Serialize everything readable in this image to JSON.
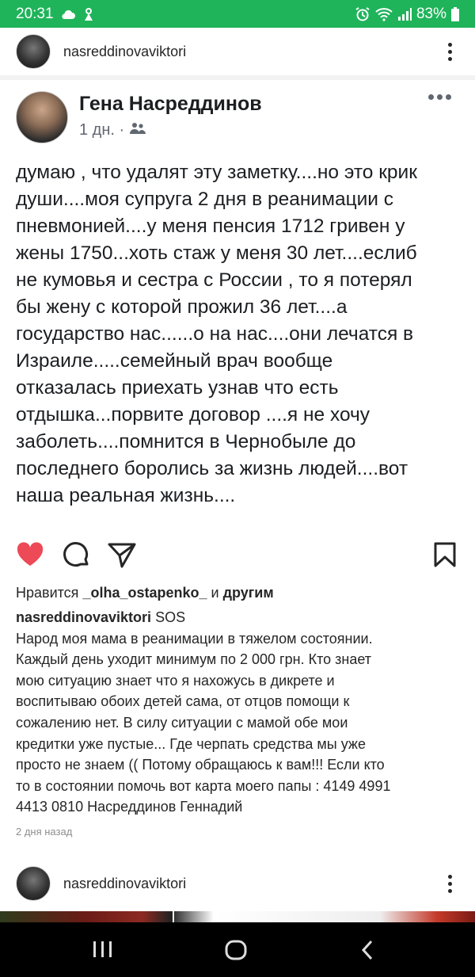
{
  "status_bar": {
    "time": "20:31",
    "battery": "83%"
  },
  "post": {
    "username": "nasreddinovaviktori",
    "image": {
      "author": "Гена Насреддинов",
      "meta": "1 дн. ·",
      "text": "думаю , что удалят эту заметку....но это крик\nдуши....моя супруга 2 дня в реанимации с\nпневмонией....у меня пенсия 1712 гривен у\nжены 1750...хоть стаж у меня 30 лет....еслиб\nне кумовья и сестра с России , то я потерял\nбы жену с которой прожил 36 лет....а\nгосударство нас......о на нас....они лечатся в\nИзраиле.....семейный врач вообще\nотказалась приехать узнав что есть\nотдышка...порвите договор ....я не хочу\nзаболеть....помнится в Чернобыле до\nпоследнего боролись за жизнь людей....вот\nнаша реальная жизнь...."
    },
    "likes": {
      "prefix": "Нравится ",
      "user": "_olha_ostapenko_",
      "middle": " и ",
      "others": "другим"
    },
    "caption": {
      "user": "nasreddinovaviktori",
      "text": " SOS\nНарод моя мама в реанимации в тяжелом состоянии.\nКаждый день уходит минимум по 2 000 грн. Кто знает\nмою ситуацию знает что я нахожусь в дикрете и\nвоспитываю обоих детей сама, от отцов помощи к\nсожалению  нет. В силу ситуации с мамой обе мои\nкредитки уже пустые... Где черпать средства мы уже\nпросто не знаем (( Потому обращаюсь к вам!!! Если кто\nто в состоянии помочь  вот карта моего папы : 4149 4991\n4413 0810 Насреддинов Геннадий"
    },
    "time_ago": "2 дня назад"
  },
  "next_post": {
    "username": "nasreddinovaviktori"
  },
  "colors": {
    "status_bar": "#1fb45a",
    "heart": "#ed4956",
    "text": "#262626",
    "muted": "#8e8e8e"
  },
  "icons": {
    "status": [
      "cloud-icon",
      "app-icon",
      "alarm-icon",
      "wifi-icon",
      "signal-icon",
      "battery-icon"
    ],
    "actions": [
      "heart-icon",
      "comment-icon",
      "share-icon",
      "bookmark-icon"
    ],
    "nav": [
      "recents-icon",
      "home-icon",
      "back-icon"
    ]
  }
}
